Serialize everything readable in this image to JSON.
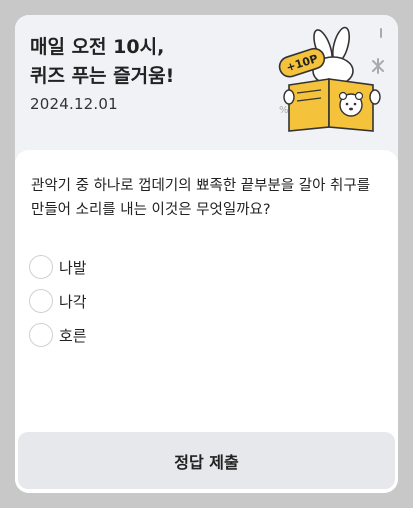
{
  "header": {
    "title_line1": "매일 오전 10시,",
    "title_line2": "퀴즈 푸는 즐거움!",
    "date": "2024.12.01",
    "badge": "+10P"
  },
  "quiz": {
    "question": "관악기 중 하나로 껍데기의 뾰족한 끝부분을 갈아 취구를 만들어 소리를 내는 이것은 무엇일까요?",
    "options": [
      {
        "label": "나발"
      },
      {
        "label": "나각"
      },
      {
        "label": "호른"
      }
    ]
  },
  "submit": {
    "label": "정답 제출"
  },
  "colors": {
    "accent": "#f5c23b",
    "hero_bg": "#f1f2f5",
    "button_bg": "#e7e8ec",
    "outer_bg": "#c8c8c8"
  }
}
